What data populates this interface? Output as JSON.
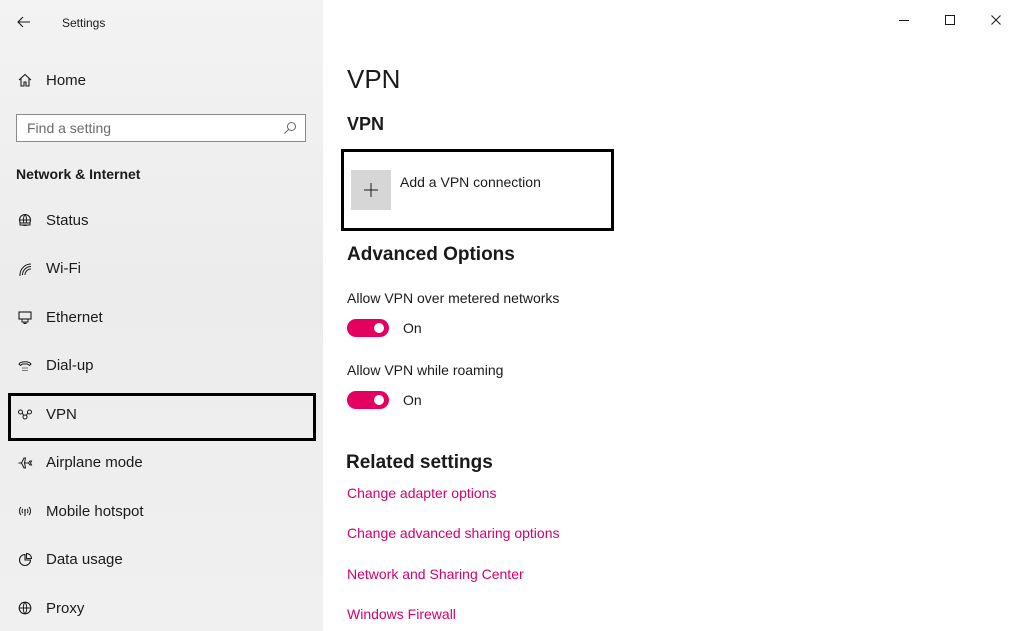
{
  "window": {
    "title": "Settings"
  },
  "sidebar": {
    "home_label": "Home",
    "search": {
      "placeholder": "Find a setting",
      "value": ""
    },
    "section_heading": "Network & Internet",
    "items": [
      {
        "label": "Status",
        "icon": "globe-icon"
      },
      {
        "label": "Wi-Fi",
        "icon": "wifi-icon"
      },
      {
        "label": "Ethernet",
        "icon": "ethernet-icon"
      },
      {
        "label": "Dial-up",
        "icon": "dialup-icon"
      },
      {
        "label": "VPN",
        "icon": "vpn-icon",
        "selected": true
      },
      {
        "label": "Airplane mode",
        "icon": "airplane-icon"
      },
      {
        "label": "Mobile hotspot",
        "icon": "hotspot-icon"
      },
      {
        "label": "Data usage",
        "icon": "data-usage-icon"
      },
      {
        "label": "Proxy",
        "icon": "globe-icon"
      }
    ]
  },
  "main": {
    "page_title": "VPN",
    "sub_title": "VPN",
    "add_vpn_label": "Add a VPN connection",
    "advanced_title": "Advanced Options",
    "options": [
      {
        "label": "Allow VPN over metered networks",
        "state": "On",
        "on": true
      },
      {
        "label": "Allow VPN while roaming",
        "state": "On",
        "on": true
      }
    ],
    "related_title": "Related settings",
    "links": [
      "Change adapter options",
      "Change advanced sharing options",
      "Network and Sharing Center",
      "Windows Firewall"
    ]
  },
  "colors": {
    "accent": "#e3005e",
    "link": "#d4006c",
    "sidebar_bg": "#f0f0f0",
    "highlight_border": "#000000"
  }
}
